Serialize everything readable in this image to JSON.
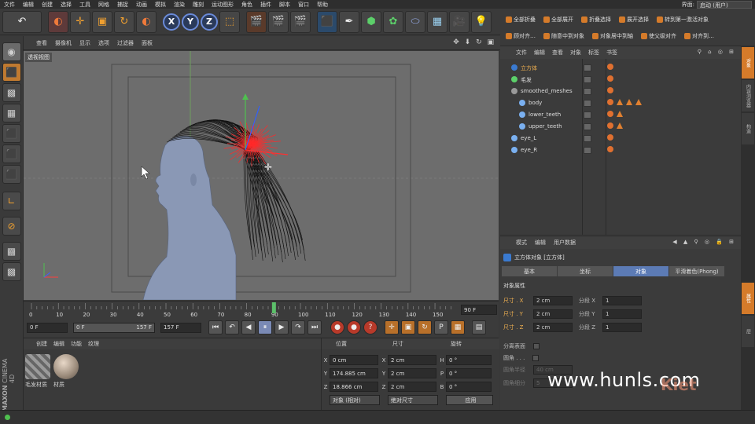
{
  "menubar": {
    "items": [
      "文件",
      "编辑",
      "创建",
      "选择",
      "工具",
      "网格",
      "捕捉",
      "动画",
      "模拟",
      "渲染",
      "雕刻",
      "运动图形",
      "角色",
      "插件",
      "脚本",
      "窗口",
      "帮助"
    ],
    "interface_label": "界面:",
    "interface_value": "启动 (用户)"
  },
  "toolbar": {
    "undo_icon": "undo-icon",
    "axis_x": "X",
    "axis_y": "Y",
    "axis_z": "Z"
  },
  "right_toolbar": {
    "row1": [
      "全部折叠",
      "全部展开",
      "折叠选择",
      "展开选择",
      "转到第一激活对象"
    ],
    "row2": [
      "顾对齐…",
      "随意中到对象",
      "对象居中到轴",
      "使父级对齐",
      "对齐到…"
    ]
  },
  "viewport": {
    "menu": [
      "查看",
      "摄像机",
      "显示",
      "选项",
      "过滤器",
      "面板"
    ],
    "label": "透视视图"
  },
  "timeline": {
    "ticks": [
      "0",
      "10",
      "20",
      "30",
      "40",
      "50",
      "60",
      "70",
      "80",
      "90",
      "100",
      "110",
      "120",
      "130",
      "140",
      "150"
    ],
    "current": 90,
    "frame_display": "90 F"
  },
  "transport": {
    "start": "0 F",
    "range_start": "0 F",
    "range_end": "157 F",
    "end": "157 F"
  },
  "materials": {
    "menu": [
      "创建",
      "编辑",
      "功能",
      "纹理"
    ],
    "items": [
      {
        "name": "毛发材质"
      },
      {
        "name": "材质"
      }
    ]
  },
  "coords": {
    "headers": [
      "位置",
      "尺寸",
      "旋转"
    ],
    "rows": [
      {
        "axis": "X",
        "pos": "0 cm",
        "size_axis": "X",
        "size": "2 cm",
        "rot_axis": "H",
        "rot": "0 °"
      },
      {
        "axis": "Y",
        "pos": "174.885 cm",
        "size_axis": "Y",
        "size": "2 cm",
        "rot_axis": "P",
        "rot": "0 °"
      },
      {
        "axis": "Z",
        "pos": "18.866 cm",
        "size_axis": "Z",
        "size": "2 cm",
        "rot_axis": "B",
        "rot": "0 °"
      }
    ],
    "mode": "对象 (相对)",
    "size_mode": "绝对尺寸",
    "apply": "应用"
  },
  "object_manager": {
    "menu": [
      "文件",
      "编辑",
      "查看",
      "对象",
      "标签",
      "书签"
    ],
    "objects": [
      {
        "name": "立方体",
        "indent": 0,
        "selected": true
      },
      {
        "name": "毛发",
        "indent": 0,
        "selected": false
      },
      {
        "name": "smoothed_meshes",
        "indent": 0,
        "selected": false
      },
      {
        "name": "body",
        "indent": 1,
        "selected": false
      },
      {
        "name": "lower_teeth",
        "indent": 1,
        "selected": false
      },
      {
        "name": "upper_teeth",
        "indent": 1,
        "selected": false
      },
      {
        "name": "eye_L",
        "indent": 0,
        "selected": false
      },
      {
        "name": "eye_R",
        "indent": 0,
        "selected": false
      }
    ]
  },
  "side_tabs": [
    "对象",
    "内容浏览器",
    "构造",
    "属性",
    "层"
  ],
  "attributes": {
    "menu": [
      "模式",
      "编辑",
      "用户数据"
    ],
    "title": "立方体对象 [立方体]",
    "tabs": [
      "基本",
      "坐标",
      "对象",
      "平滑着色(Phong)"
    ],
    "active_tab": "对象",
    "section": "对象属性",
    "rows": [
      {
        "label": "尺寸 . X",
        "value": "2 cm",
        "seg_label": "分段 X",
        "seg": "1"
      },
      {
        "label": "尺寸 . Y",
        "value": "2 cm",
        "seg_label": "分段 Y",
        "seg": "1"
      },
      {
        "label": "尺寸 . Z",
        "value": "2 cm",
        "seg_label": "分段 Z",
        "seg": "1"
      }
    ],
    "separate_surfaces": "分离表面",
    "fillet": "圆角 . . .",
    "fillet_radius_label": "圆角半径",
    "fillet_radius": "40 cm",
    "fillet_subdiv_label": "圆角细分",
    "fillet_subdiv": "5"
  },
  "brand": {
    "maxon": "MAXON",
    "cinema": "CINEMA 4D"
  },
  "watermark": "www.hunls.com",
  "watermark2": "Kiet"
}
